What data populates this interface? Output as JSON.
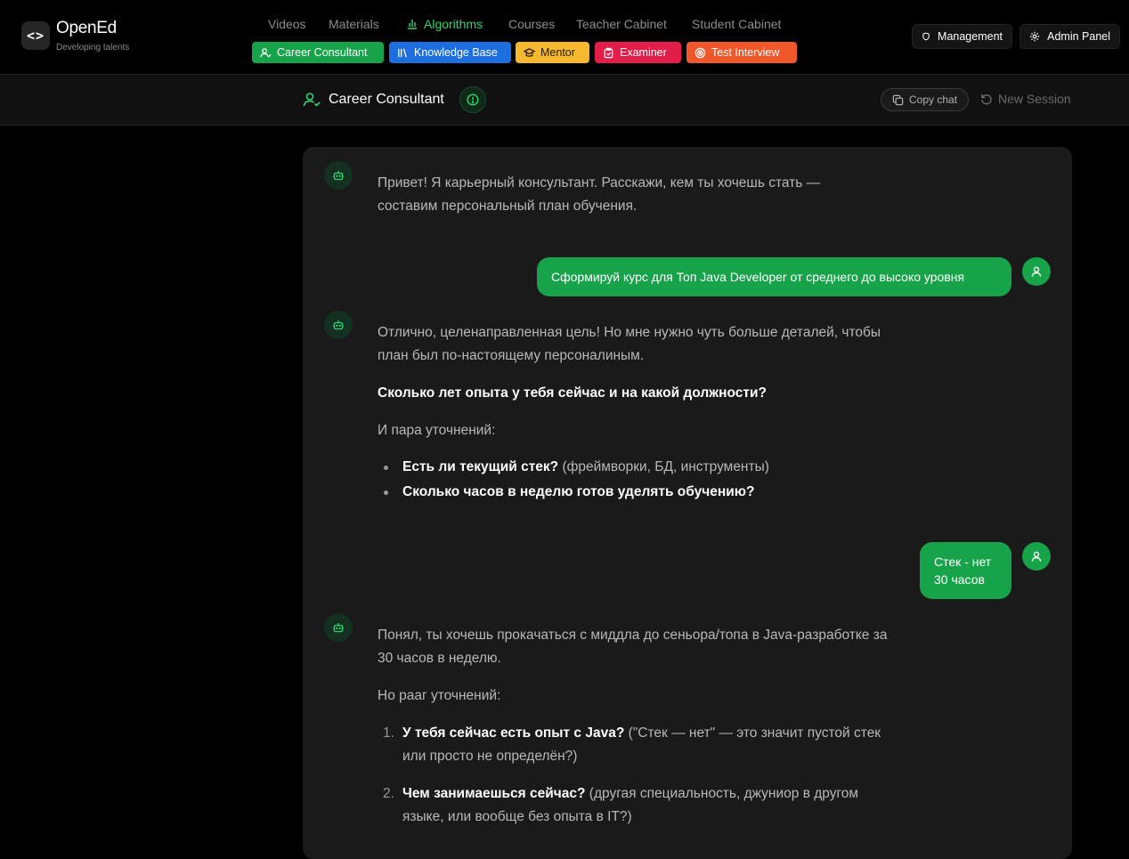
{
  "header": {
    "logo_glyph": "<>",
    "app_name": "OpenEd",
    "tagline": "Developing talents",
    "nav": [
      "Videos",
      "Materials",
      "Algorithms",
      "Courses",
      "Teacher Cabinet",
      "Student Cabinet"
    ],
    "active_nav": "Algorithms",
    "pills": [
      {
        "label": "Career Consultant",
        "color": "#16a34a"
      },
      {
        "label": "Knowledge Base",
        "color": "#1d6fe0"
      },
      {
        "label": "Mentor",
        "color": "#f5b82e"
      },
      {
        "label": "Examiner",
        "color": "#e11d48"
      },
      {
        "label": "Test Interview",
        "color": "#f0572a"
      }
    ],
    "management_label": "Management",
    "admin_label": "Admin Panel"
  },
  "subheader": {
    "title": "Career Consultant",
    "copy_label": "Copy chat",
    "new_session_label": "New Session"
  },
  "chat": {
    "m1": "Привет! Я карьерный консультант. Расскажи, кем ты хочешь стать — составим персональный план обучения.",
    "u1": "Сформируй курс для Топ Java Developer от среднего до высоко уровня",
    "m2_p1": "Отлично, целенаправленная цель! Но мне нужно чуть больше деталей, чтобы план был по-настоящему персоналиным.",
    "m2_q": "Сколько лет опыта у тебя сейчас и на какой должности?",
    "m2_p2": "И пара уточнений:",
    "m2_b1_bold": "Есть ли текущий стек?",
    "m2_b1_rest": " (фреймворки, БД, инструменты)",
    "m2_b2_bold": "Сколько часов в неделю готов уделять обучению?",
    "u2_l1": "Стек - нет",
    "u2_l2": "30 часов",
    "m3_p1": "Понял, ты хочешь прокачаться с миддла до сеньора/топа в Java-разработке за 30 часов в неделю.",
    "m3_p2": "Но рааг уточнений:",
    "m3_n1": "1.",
    "m3_i1_bold": "У тебя сейчас есть опыт с Java?",
    "m3_i1_rest": " (\"Стек — нет\" — это значит пустой стек или просто не определён?)",
    "m3_n2": "2.",
    "m3_i2_bold": "Чем занимаешься сейчас?",
    "m3_i2_rest": " (другая специальность, джуниор в другом языке, или вообще без опыта в IT?)"
  },
  "icons": {
    "logo": "code-icon",
    "algorithms": "bar-chart-icon",
    "management": "shield-icon",
    "admin": "gear-icon",
    "consultant": "user-check-icon",
    "info": "info-circle-icon",
    "copy": "copy-icon",
    "refresh": "rotate-ccw-icon",
    "bot": "bot-icon",
    "user": "user-icon"
  },
  "colors": {
    "accent": "#16a34a",
    "background": "#000000",
    "chat_panel": "#1a1a1a"
  }
}
